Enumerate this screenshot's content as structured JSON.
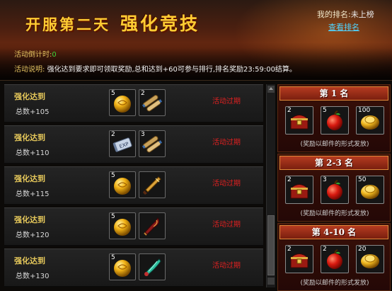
{
  "header": {
    "title_part1": "开服第二天",
    "title_part2": "强化竞技",
    "my_rank_label": "我的排名:",
    "my_rank_value": "未上榜",
    "view_rank_link": "查看排名",
    "countdown_label": "活动倒计时:",
    "countdown_value": "0",
    "desc_label": "活动说明:",
    "desc_text": "强化达到要求即可领取奖励,总和达到+60可参与排行,排名奖励23:59:00结算。"
  },
  "tasks": [
    {
      "title": "强化达到",
      "total": "总数+105",
      "status": "活动过期",
      "rewards": [
        {
          "icon": "gold-orb-icon",
          "count": "5"
        },
        {
          "icon": "scroll-bundle-icon",
          "count": "2"
        }
      ]
    },
    {
      "title": "强化达到",
      "total": "总数+110",
      "status": "活动过期",
      "rewards": [
        {
          "icon": "exp-scroll-icon",
          "count": "2"
        },
        {
          "icon": "scroll-bundle-icon",
          "count": "3"
        }
      ]
    },
    {
      "title": "强化达到",
      "total": "总数+115",
      "status": "活动过期",
      "rewards": [
        {
          "icon": "gold-orb-icon",
          "count": "5"
        },
        {
          "icon": "golden-blade-icon",
          "count": ""
        }
      ]
    },
    {
      "title": "强化达到",
      "total": "总数+120",
      "status": "活动过期",
      "rewards": [
        {
          "icon": "gold-orb-icon",
          "count": "5"
        },
        {
          "icon": "crimson-blade-icon",
          "count": ""
        }
      ]
    },
    {
      "title": "强化达到",
      "total": "总数+130",
      "status": "活动过期",
      "rewards": [
        {
          "icon": "gold-orb-icon",
          "count": "5"
        },
        {
          "icon": "jade-blade-icon",
          "count": ""
        }
      ]
    }
  ],
  "rank_rewards": [
    {
      "label": "第 1 名",
      "note": "(奖励以邮件的形式发放)",
      "items": [
        {
          "icon": "treasure-chest-icon",
          "count": "2"
        },
        {
          "icon": "red-apple-icon",
          "count": "5"
        },
        {
          "icon": "gold-ingot-icon",
          "count": "100"
        }
      ]
    },
    {
      "label": "第 2-3 名",
      "note": "(奖励以邮件的形式发放)",
      "items": [
        {
          "icon": "treasure-chest-icon",
          "count": "2"
        },
        {
          "icon": "red-apple-icon",
          "count": "3"
        },
        {
          "icon": "gold-ingot-icon",
          "count": "50"
        }
      ]
    },
    {
      "label": "第 4-10 名",
      "note": "(奖励以邮件的形式发放)",
      "items": [
        {
          "icon": "treasure-chest-icon",
          "count": "2"
        },
        {
          "icon": "red-apple-icon",
          "count": "2"
        },
        {
          "icon": "gold-ingot-icon",
          "count": "20"
        }
      ]
    }
  ],
  "colors": {
    "title_gold": "#ffcc33",
    "expired_red": "#e02020",
    "link_cyan": "#4fd4ff",
    "countdown_green": "#39d439"
  }
}
